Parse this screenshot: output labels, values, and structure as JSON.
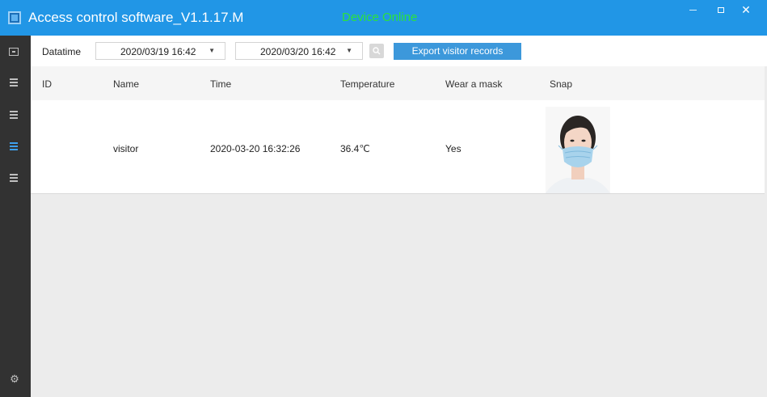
{
  "app": {
    "title": "Access control software_V1.1.17.M",
    "device_status": "Device Online",
    "window_controls": {
      "minimize": "—",
      "maximize": "□",
      "close": "✕"
    }
  },
  "sidebar": {
    "items": [
      {
        "icon": "device-icon",
        "active": false
      },
      {
        "icon": "list-icon",
        "active": false
      },
      {
        "icon": "list-icon",
        "active": false
      },
      {
        "icon": "list-icon",
        "active": true
      },
      {
        "icon": "list-icon",
        "active": false
      }
    ],
    "settings_icon": "gear-icon"
  },
  "filter": {
    "label": "Datatime",
    "start": "2020/03/19 16:42",
    "end": "2020/03/20 16:42",
    "dropdown_arrow": "▼",
    "search_icon": "search-icon",
    "export_label": "Export visitor records"
  },
  "table": {
    "headers": [
      "ID",
      "Name",
      "Time",
      "Temperature",
      "Wear a mask",
      "Snap"
    ],
    "rows": [
      {
        "id": "",
        "name": "visitor",
        "time": "2020-03-20 16:32:26",
        "temperature": "36.4℃",
        "mask": "Yes",
        "snap": "visitor-face-photo"
      }
    ]
  },
  "colors": {
    "titlebar": "#2196e6",
    "status_online": "#2be33b",
    "sidebar": "#323232",
    "accent_button": "#3c98db"
  }
}
